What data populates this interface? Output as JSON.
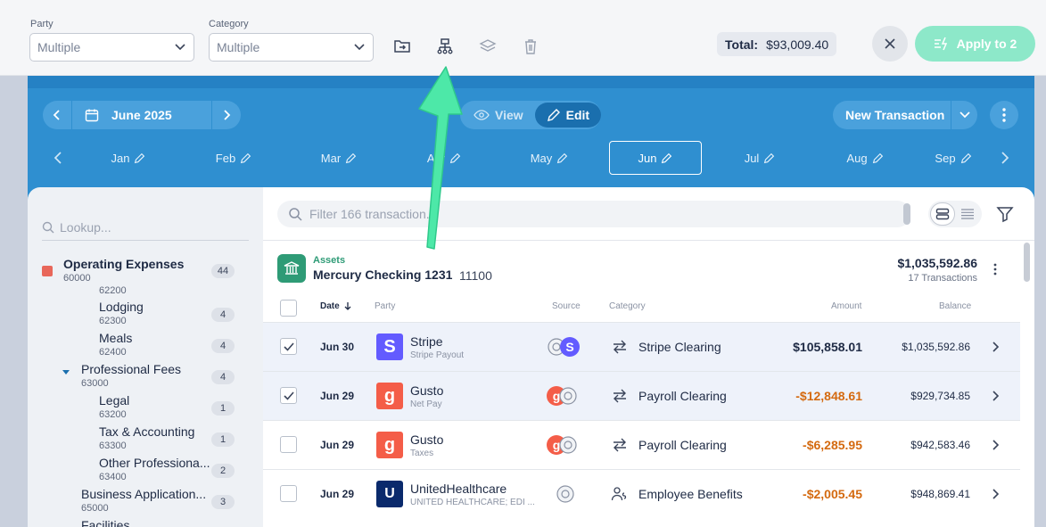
{
  "toolbar": {
    "party_label": "Party",
    "party_value": "Multiple",
    "category_label": "Category",
    "category_value": "Multiple",
    "total_label": "Total:",
    "total_value": "$93,009.40",
    "apply_label": "Apply to 2",
    "icons": [
      "move-to-folder-icon",
      "hierarchy-icon",
      "layers-icon",
      "trash-icon"
    ]
  },
  "period": {
    "label": "June 2025",
    "view_label": "View",
    "edit_label": "Edit",
    "active_mode": "Edit",
    "new_transaction_label": "New Transaction",
    "months": [
      "Jan",
      "Feb",
      "Mar",
      "Apr",
      "May",
      "Jun",
      "Jul",
      "Aug",
      "Sep"
    ],
    "active_month": "Jun"
  },
  "sidebar": {
    "lookup_placeholder": "Lookup...",
    "items": [
      {
        "name": "Operating Expenses",
        "code": "60000",
        "count": "44"
      },
      {
        "name": "",
        "code": "62200",
        "count": ""
      },
      {
        "name": "Lodging",
        "code": "62300",
        "count": "4"
      },
      {
        "name": "Meals",
        "code": "62400",
        "count": "4"
      },
      {
        "name": "Professional Fees",
        "code": "63000",
        "count": "4"
      },
      {
        "name": "Legal",
        "code": "63200",
        "count": "1"
      },
      {
        "name": "Tax & Accounting",
        "code": "63300",
        "count": "1"
      },
      {
        "name": "Other Professiona...",
        "code": "63400",
        "count": "2"
      },
      {
        "name": "Business Application...",
        "code": "65000",
        "count": "3"
      },
      {
        "name": "Facilities",
        "code": "",
        "count": ""
      }
    ]
  },
  "main": {
    "filter_placeholder": "Filter 166 transaction...",
    "account": {
      "type": "Assets",
      "name": "Mercury Checking 1231",
      "number": "11100",
      "balance": "$1,035,592.86",
      "transactions": "17 Transactions"
    },
    "columns": {
      "date": "Date",
      "party": "Party",
      "source": "Source",
      "category": "Category",
      "amount": "Amount",
      "balance": "Balance"
    },
    "rows": [
      {
        "date": "Jun 30",
        "party": "Stripe",
        "sub": "Stripe Payout",
        "logo": "S",
        "category": "Stripe Clearing",
        "amount": "$105,858.01",
        "balance": "$1,035,592.86",
        "checked": true
      },
      {
        "date": "Jun 29",
        "party": "Gusto",
        "sub": "Net Pay",
        "logo": "g",
        "category": "Payroll Clearing",
        "amount": "-$12,848.61",
        "balance": "$929,734.85",
        "checked": true
      },
      {
        "date": "Jun 29",
        "party": "Gusto",
        "sub": "Taxes",
        "logo": "g",
        "category": "Payroll Clearing",
        "amount": "-$6,285.95",
        "balance": "$942,583.46",
        "checked": false
      },
      {
        "date": "Jun 29",
        "party": "UnitedHealthcare",
        "sub": "UNITED HEALTHCARE; EDI ...",
        "logo": "U",
        "category": "Employee Benefits",
        "amount": "-$2,005.45",
        "balance": "$948,869.41",
        "checked": false
      }
    ]
  },
  "colors": {
    "accent": "#2f8fd0",
    "green": "#2e9b76",
    "negative": "#d46a10",
    "apply": "#8de8c9",
    "arrow": "#4de8a8"
  }
}
